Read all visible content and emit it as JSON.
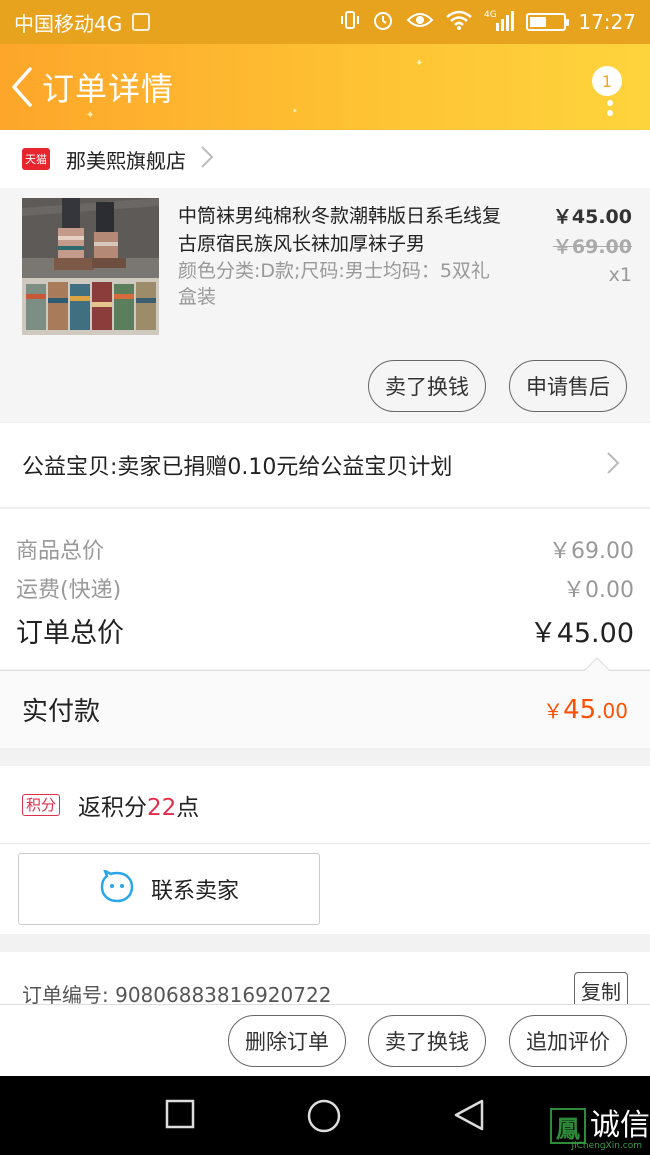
{
  "status_bar": {
    "carrier": "中国移动4G",
    "network": "4G",
    "time": "17:27",
    "battery_level": 0.5
  },
  "header": {
    "title": "订单详情",
    "badge_count": "1"
  },
  "shop": {
    "platform_tag": "天猫",
    "name": "那美熙旗舰店"
  },
  "product": {
    "title": "中筒袜男纯棉秋冬款潮韩版日系毛线复古原宿民族风长袜加厚袜子男",
    "spec": "颜色分类:D款;尺码:男士均码：5双礼盒装",
    "price": "￥45.00",
    "original_price": "￥69.00",
    "quantity": "x1",
    "sell_button": "卖了换钱",
    "aftersale_button": "申请售后"
  },
  "charity": {
    "text": "公益宝贝:卖家已捐赠0.10元给公益宝贝计划"
  },
  "summary": {
    "goods_label": "商品总价",
    "goods_value": "￥69.00",
    "shipping_label": "运费(快递)",
    "shipping_value": "￥0.00",
    "order_total_label": "订单总价",
    "order_total_value": "￥45.00"
  },
  "paid": {
    "label": "实付款",
    "currency": "￥",
    "amount_int": "45",
    "amount_dec": ".00"
  },
  "points": {
    "tag": "积分",
    "prefix": "返积分",
    "value": "22",
    "suffix": "点"
  },
  "contact": {
    "label": "联系卖家"
  },
  "order_info": {
    "order_number": "订单编号: 90806883816920722",
    "copy_label": "复制"
  },
  "bottom_actions": {
    "delete": "删除订单",
    "sell": "卖了换钱",
    "review": "追加评价"
  },
  "watermark": {
    "box_char": "鳳",
    "text": "诚信",
    "sub": "JiChengXin.com"
  },
  "colors": {
    "header_orange": "#fda62a",
    "price_orange": "#ff5000",
    "points_red": "#e02e4b",
    "tmall_red": "#e8242d"
  }
}
